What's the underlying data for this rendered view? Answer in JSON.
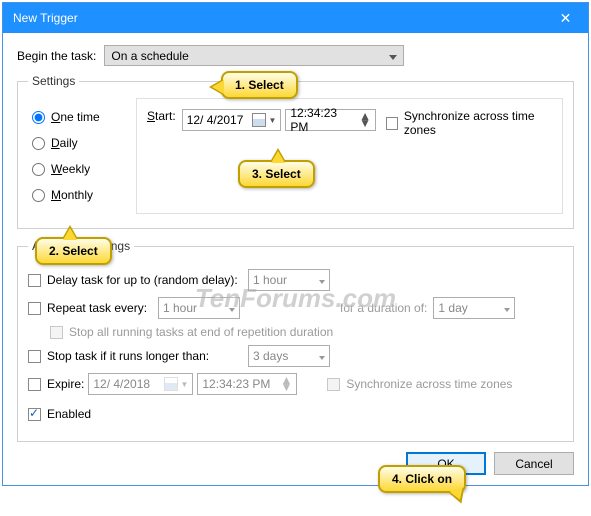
{
  "title": "New Trigger",
  "begin_label": "Begin the task:",
  "begin_value": "On a schedule",
  "settings": {
    "legend": "Settings",
    "radios": {
      "one_time": "One time",
      "daily": "Daily",
      "weekly": "Weekly",
      "monthly": "Monthly"
    },
    "start_label": "Start:",
    "start_date": "12/ 4/2017",
    "start_time": "12:34:23 PM",
    "sync_label": "Synchronize across time zones"
  },
  "advanced": {
    "legend": "Advanced settings",
    "delay_label": "Delay task for up to (random delay):",
    "delay_value": "1 hour",
    "repeat_label": "Repeat task every:",
    "repeat_value": "1 hour",
    "duration_label": "for a duration of:",
    "duration_value": "1 day",
    "stop_all_label": "Stop all running tasks at end of repetition duration",
    "stop_if_label": "Stop task if it runs longer than:",
    "stop_if_value": "3 days",
    "expire_label": "Expire:",
    "expire_date": "12/ 4/2018",
    "expire_time": "12:34:23 PM",
    "expire_sync": "Synchronize across time zones",
    "enabled_label": "Enabled"
  },
  "buttons": {
    "ok": "OK",
    "cancel": "Cancel"
  },
  "callouts": {
    "c1": "1. Select",
    "c2": "2. Select",
    "c3": "3. Select",
    "c4": "4. Click on"
  },
  "watermark": "TenForums.com"
}
